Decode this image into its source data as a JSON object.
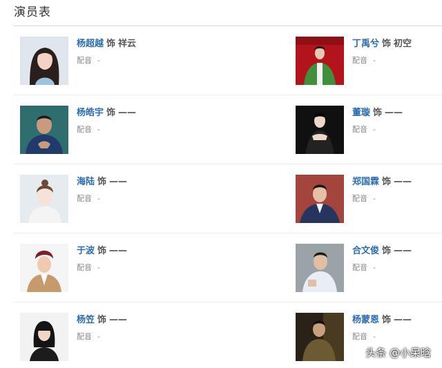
{
  "page": {
    "title": "演员表"
  },
  "labels": {
    "role_prefix": "饰",
    "dub_label": "配音",
    "dub_value": "-"
  },
  "cast": [
    {
      "left": {
        "actor": "杨超越",
        "role": "祥云",
        "photo": "portrait-woman-long-dark-hair"
      },
      "right": {
        "actor": "丁禹兮",
        "role": "初空",
        "photo": "portrait-man-red-background"
      }
    },
    {
      "left": {
        "actor": "杨皓宇",
        "role": "——",
        "photo": "portrait-man-teal-background"
      },
      "right": {
        "actor": "董璇",
        "role": "——",
        "photo": "portrait-woman-dark-background"
      }
    },
    {
      "left": {
        "actor": "海陆",
        "role": "——",
        "photo": "portrait-woman-light-background"
      },
      "right": {
        "actor": "郑国霖",
        "role": "——",
        "photo": "portrait-man-red-brown-background"
      }
    },
    {
      "left": {
        "actor": "于波",
        "role": "——",
        "photo": "portrait-man-white-background"
      },
      "right": {
        "actor": "合文俊",
        "role": "——",
        "photo": "portrait-man-grey-background"
      }
    },
    {
      "left": {
        "actor": "杨笠",
        "role": "——",
        "photo": "portrait-woman-white-background"
      },
      "right": {
        "actor": "杨蒙恩",
        "role": "——",
        "photo": "portrait-man-dark-background"
      }
    }
  ],
  "watermark": "头条 @小呆晗"
}
